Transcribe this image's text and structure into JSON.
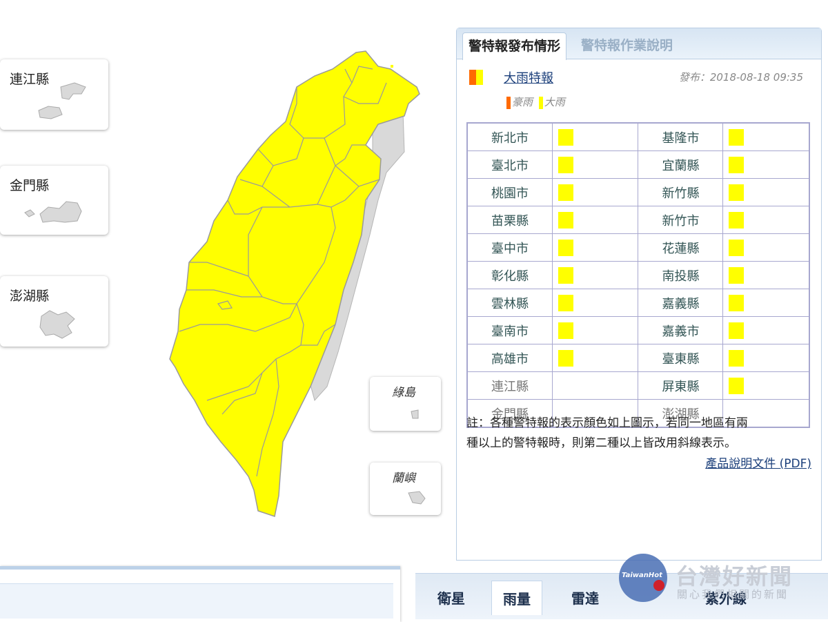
{
  "islands": {
    "lienchiang": "連江縣",
    "kinmen": "金門縣",
    "penghu": "澎湖縣",
    "green_island": "綠島",
    "orchid_island": "蘭嶼"
  },
  "panel": {
    "tab_active": "警特報發布情形",
    "tab_inactive": "警特報作業說明",
    "product_name": "大雨特報",
    "issued": "發布：2018-08-18 09:35",
    "legend": [
      {
        "label": "豪雨",
        "color": "#ff6a00"
      },
      {
        "label": "大雨",
        "color": "#ffff00"
      }
    ],
    "regions": [
      {
        "left": "新北市",
        "left_warn": true,
        "right": "基隆市",
        "right_warn": true
      },
      {
        "left": "臺北市",
        "left_warn": true,
        "right": "宜蘭縣",
        "right_warn": true
      },
      {
        "left": "桃園市",
        "left_warn": true,
        "right": "新竹縣",
        "right_warn": true
      },
      {
        "left": "苗栗縣",
        "left_warn": true,
        "right": "新竹市",
        "right_warn": true
      },
      {
        "left": "臺中市",
        "left_warn": true,
        "right": "花蓮縣",
        "right_warn": true
      },
      {
        "left": "彰化縣",
        "left_warn": true,
        "right": "南投縣",
        "right_warn": true
      },
      {
        "left": "雲林縣",
        "left_warn": true,
        "right": "嘉義縣",
        "right_warn": true
      },
      {
        "left": "臺南市",
        "left_warn": true,
        "right": "嘉義市",
        "right_warn": true
      },
      {
        "left": "高雄市",
        "left_warn": true,
        "right": "臺東縣",
        "right_warn": true
      },
      {
        "left": "連江縣",
        "left_warn": false,
        "right": "屏東縣",
        "right_warn": true
      },
      {
        "left": "金門縣",
        "left_warn": false,
        "right": "澎湖縣",
        "right_warn": false
      }
    ],
    "note_line1": "註：各種警特報的表示顏色如上圖示，若同一地區有兩",
    "note_line2": "種以上的警特報時，則第二種以上皆改用斜線表示。",
    "pdf_link": "產品說明文件 (PDF)"
  },
  "bottom_tabs": [
    "衛星",
    "雨量",
    "雷達",
    "紫外線"
  ],
  "watermark": {
    "logo": "TaiwanHot",
    "title": "台灣好新聞",
    "subtitle": "關心我們相關的新聞"
  },
  "colors": {
    "warning_yellow": "#ffff00",
    "torrential_orange": "#ff6a00",
    "land_gray": "#d9d9d9"
  }
}
